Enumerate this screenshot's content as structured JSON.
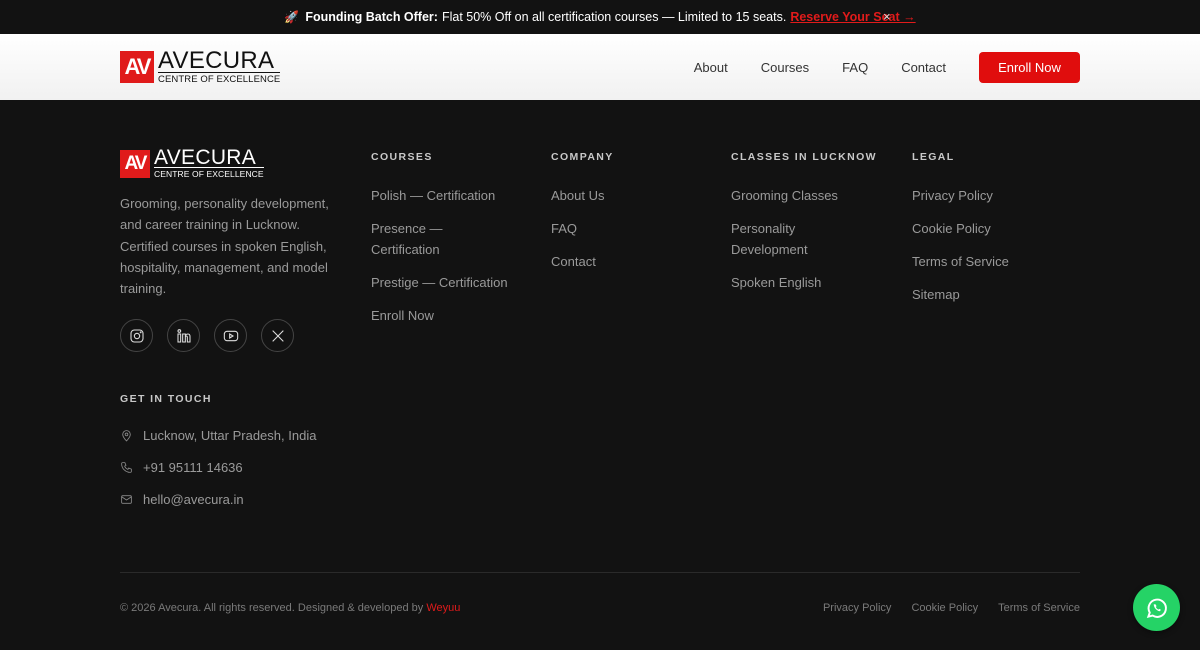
{
  "announcement": {
    "bold": "Founding Batch Offer:",
    "text": "Flat 50% Off on all certification courses — Limited to 15 seats.",
    "cta": "Reserve Your Seat →",
    "close": "×"
  },
  "header": {
    "logo_mark": "AV",
    "logo_name": "AVECURA",
    "logo_sub": "CENTRE OF EXCELLENCE",
    "nav": [
      "About",
      "Courses",
      "FAQ",
      "Contact"
    ],
    "enroll": "Enroll Now"
  },
  "footer": {
    "brand": {
      "logo_mark": "AV",
      "logo_name": "AVECURA",
      "logo_sub": "CENTRE OF EXCELLENCE",
      "description": "Grooming, personality development, and career training in Lucknow. Certified courses in spoken English, hospitality, management, and model training."
    },
    "columns": [
      {
        "heading": "COURSES",
        "links": [
          "Polish — Certification",
          "Presence — Certification",
          "Prestige — Certification",
          "Enroll Now"
        ]
      },
      {
        "heading": "COMPANY",
        "links": [
          "About Us",
          "FAQ",
          "Contact"
        ]
      },
      {
        "heading": "CLASSES IN LUCKNOW",
        "links": [
          "Grooming Classes",
          "Personality Development",
          "Spoken English"
        ]
      },
      {
        "heading": "LEGAL",
        "links": [
          "Privacy Policy",
          "Cookie Policy",
          "Terms of Service",
          "Sitemap"
        ]
      }
    ],
    "touch": {
      "heading": "GET IN TOUCH",
      "location": "Lucknow, Uttar Pradesh, India",
      "phone": "+91 95111 14636",
      "email": "hello@avecura.in"
    },
    "copyright": "© 2026 Avecura. All rights reserved. Designed & developed by",
    "developer": "Weyuu",
    "bottom_links": [
      "Privacy Policy",
      "Cookie Policy",
      "Terms of Service"
    ]
  },
  "colors": {
    "accent": "#e00d0d",
    "background": "#121212",
    "whatsapp": "#25d366"
  },
  "icons": [
    "rocket-icon",
    "close-icon",
    "instagram-icon",
    "linkedin-icon",
    "youtube-icon",
    "x-icon",
    "location-pin-icon",
    "phone-icon",
    "mail-icon",
    "whatsapp-icon"
  ]
}
